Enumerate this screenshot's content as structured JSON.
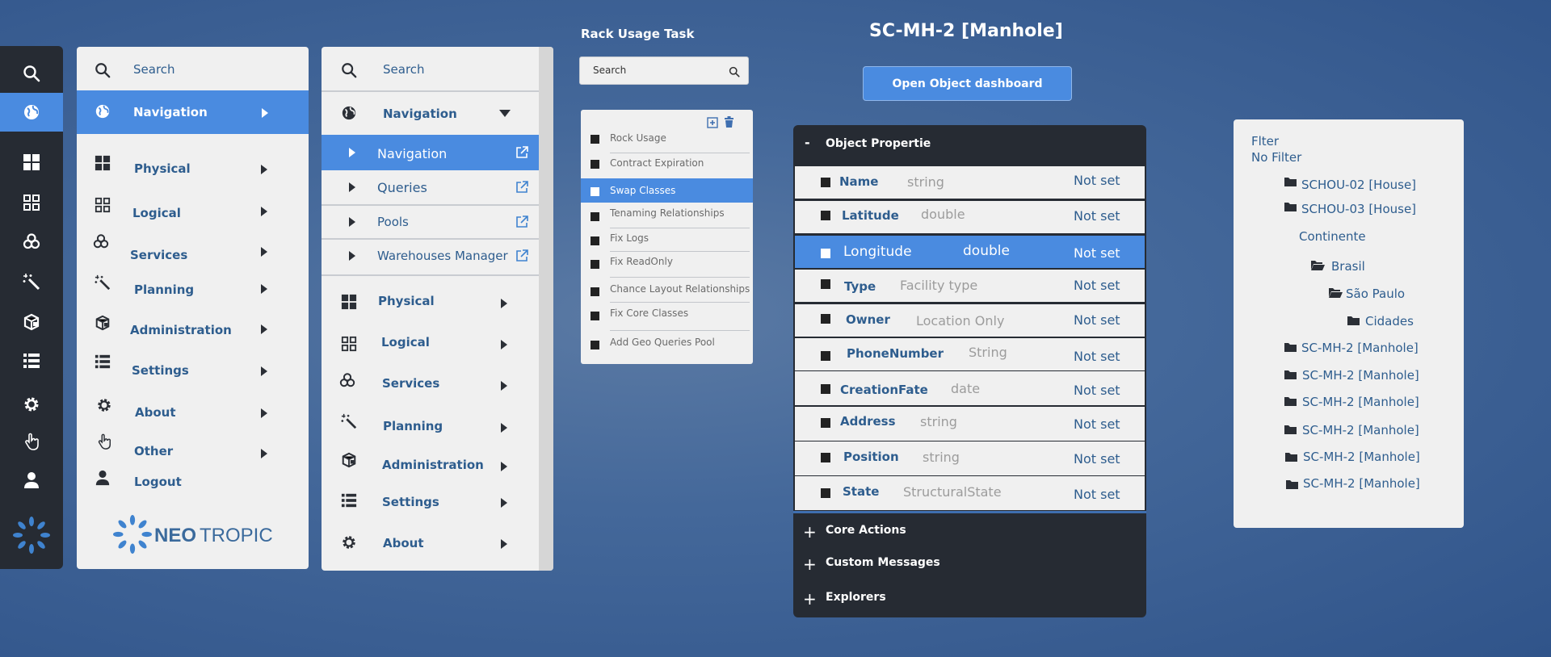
{
  "rail": {
    "icons": [
      "search-icon",
      "globe-icon",
      "dashboard-icon",
      "grid-icon",
      "services-icon",
      "wand-icon",
      "administration-icon",
      "list-icon",
      "gear-icon",
      "hand-icon",
      "user-icon",
      "neotropic-logo-icon"
    ]
  },
  "panel_a": {
    "search_label": "Search",
    "items": [
      {
        "label": "Navigation"
      },
      {
        "label": "Physical"
      },
      {
        "label": "Logical"
      },
      {
        "label": "Services"
      },
      {
        "label": "Planning"
      },
      {
        "label": "Administration"
      },
      {
        "label": "Settings"
      },
      {
        "label": "About"
      },
      {
        "label": "Other"
      },
      {
        "label": "Logout"
      }
    ],
    "logo_text_bold": "NEO",
    "logo_text_light": "TROPIC"
  },
  "panel_b": {
    "search_label": "Search",
    "navigation_header": "Navigation",
    "sub_items": [
      {
        "label": "Navigation"
      },
      {
        "label": "Queries"
      },
      {
        "label": "Pools"
      },
      {
        "label": "Warehouses Manager"
      }
    ],
    "items": [
      {
        "label": "Physical"
      },
      {
        "label": "Logical"
      },
      {
        "label": "Services"
      },
      {
        "label": "Planning"
      },
      {
        "label": "Administration"
      },
      {
        "label": "Settings"
      },
      {
        "label": "About"
      }
    ]
  },
  "rack": {
    "title": "Rack Usage Task",
    "search_placeholder": "Search",
    "items": [
      {
        "label": "Rock Usage"
      },
      {
        "label": "Contract Expiration"
      },
      {
        "label": "Swap Classes"
      },
      {
        "label": "Tenaming Relationships"
      },
      {
        "label": "Fix Logs"
      },
      {
        "label": "Fix ReadOnly"
      },
      {
        "label": "Chance Layout Relationships"
      },
      {
        "label": "Fix Core Classes"
      },
      {
        "label": "Add Geo Queries Pool"
      }
    ]
  },
  "object": {
    "title": "SC-MH-2 [Manhole]",
    "open_button": "Open Object dashboard",
    "section_properties": "Object Propertie",
    "collapse_symbol": "-",
    "properties": [
      {
        "name": "Name",
        "type": "string",
        "value": "Not set"
      },
      {
        "name": "Latitude",
        "type": "double",
        "value": "Not set"
      },
      {
        "name": "Longitude",
        "type": "double",
        "value": "Not set"
      },
      {
        "name": "Type",
        "type": "Facility type",
        "value": "Not set"
      },
      {
        "name": "Owner",
        "type": "Location Only",
        "value": "Not set"
      },
      {
        "name": "PhoneNumber",
        "type": "String",
        "value": "Not set"
      },
      {
        "name": "CreationFate",
        "type": "date",
        "value": "Not set"
      },
      {
        "name": "Address",
        "type": "string",
        "value": "Not set"
      },
      {
        "name": "Position",
        "type": "string",
        "value": "Not set"
      },
      {
        "name": "State",
        "type": "StructuralState",
        "value": "Not set"
      }
    ],
    "sections": [
      {
        "label": "Core Actions"
      },
      {
        "label": "Custom Messages"
      },
      {
        "label": "Explorers"
      }
    ]
  },
  "tree": {
    "filter_label": "Flter",
    "filter_value": "No Filter",
    "nodes": [
      {
        "label": "SCHOU-02 [House]",
        "folder": "closed"
      },
      {
        "label": "SCHOU-03 [House]",
        "folder": "closed"
      },
      {
        "label": "Continente",
        "folder": "none"
      },
      {
        "label": "Brasil",
        "folder": "open"
      },
      {
        "label": "São Paulo",
        "folder": "open"
      },
      {
        "label": "Cidades",
        "folder": "closed"
      },
      {
        "label": "SC-MH-2 [Manhole]",
        "folder": "closed"
      },
      {
        "label": "SC-MH-2 [Manhole]",
        "folder": "closed"
      },
      {
        "label": "SC-MH-2 [Manhole]",
        "folder": "closed"
      },
      {
        "label": "SC-MH-2 [Manhole]",
        "folder": "closed"
      },
      {
        "label": "SC-MH-2 [Manhole]",
        "folder": "closed"
      },
      {
        "label": "SC-MH-2 [Manhole]",
        "folder": "closed"
      }
    ]
  },
  "colors": {
    "accent": "#4a8be0",
    "dark": "#262b33",
    "panel": "#f0f0f0",
    "text_blue": "#2e5d8e"
  }
}
